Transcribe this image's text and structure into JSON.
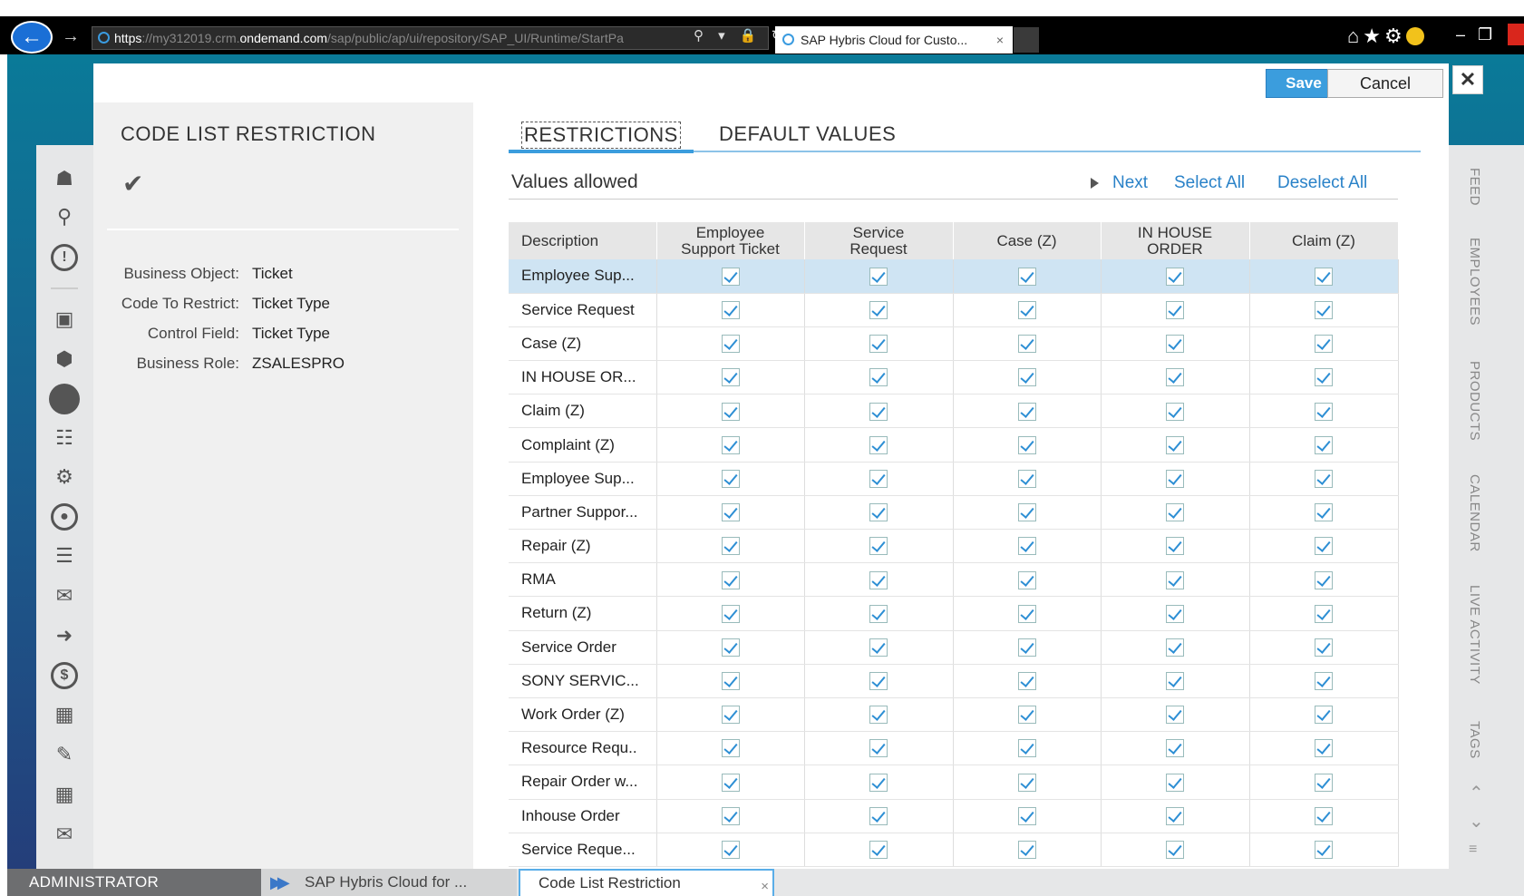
{
  "browser": {
    "url_scheme": "https",
    "url_pre": "://my312019.crm.",
    "url_domain": "ondemand.com",
    "url_path": "/sap/public/ap/ui/repository/SAP_UI/Runtime/StartPa",
    "tab_title": "SAP Hybris Cloud for Custo...",
    "tab_close": "×"
  },
  "dialog": {
    "title": "CODE LIST RESTRICTION",
    "save_label": "Save",
    "cancel_label": "Cancel",
    "close_label": "✕"
  },
  "fields": [
    {
      "label": "Business Object:",
      "value": "Ticket"
    },
    {
      "label": "Code To Restrict:",
      "value": "Ticket Type"
    },
    {
      "label": "Control Field:",
      "value": "Ticket Type"
    },
    {
      "label": "Business Role:",
      "value": "ZSALESPRO"
    }
  ],
  "tabs": {
    "restrictions": "RESTRICTIONS",
    "default_values": "DEFAULT VALUES"
  },
  "values_section": {
    "title": "Values allowed",
    "next": "Next",
    "select_all": "Select All",
    "deselect_all": "Deselect All"
  },
  "table": {
    "headers": [
      "Description",
      "Employee Support Ticket",
      "Service Request",
      "Case (Z)",
      "IN HOUSE ORDER",
      "Claim (Z)"
    ],
    "header_lines": [
      [
        "Description"
      ],
      [
        "Employee",
        "Support Ticket"
      ],
      [
        "Service",
        "Request"
      ],
      [
        "Case (Z)"
      ],
      [
        "IN HOUSE",
        "ORDER"
      ],
      [
        "Claim (Z)"
      ]
    ],
    "rows": [
      {
        "desc": "Employee Sup...",
        "checked": [
          true,
          true,
          true,
          true,
          true
        ],
        "selected": true
      },
      {
        "desc": "Service Request",
        "checked": [
          true,
          true,
          true,
          true,
          true
        ]
      },
      {
        "desc": "Case (Z)",
        "checked": [
          true,
          true,
          true,
          true,
          true
        ]
      },
      {
        "desc": "IN HOUSE OR...",
        "checked": [
          true,
          true,
          true,
          true,
          true
        ]
      },
      {
        "desc": "Claim (Z)",
        "checked": [
          true,
          true,
          true,
          true,
          true
        ]
      },
      {
        "desc": "Complaint (Z)",
        "checked": [
          true,
          true,
          true,
          true,
          true
        ]
      },
      {
        "desc": "Employee Sup...",
        "checked": [
          true,
          true,
          true,
          true,
          true
        ]
      },
      {
        "desc": "Partner Suppor...",
        "checked": [
          true,
          true,
          true,
          true,
          true
        ]
      },
      {
        "desc": "Repair (Z)",
        "checked": [
          true,
          true,
          true,
          true,
          true
        ]
      },
      {
        "desc": "RMA",
        "checked": [
          true,
          true,
          true,
          true,
          true
        ]
      },
      {
        "desc": "Return (Z)",
        "checked": [
          true,
          true,
          true,
          true,
          true
        ]
      },
      {
        "desc": "Service Order",
        "checked": [
          true,
          true,
          true,
          true,
          true
        ]
      },
      {
        "desc": "SONY SERVIC...",
        "checked": [
          true,
          true,
          true,
          true,
          true
        ]
      },
      {
        "desc": "Work Order (Z)",
        "checked": [
          true,
          true,
          true,
          true,
          true
        ]
      },
      {
        "desc": "Resource Requ..",
        "checked": [
          true,
          true,
          true,
          true,
          true
        ]
      },
      {
        "desc": "Repair Order w...",
        "checked": [
          true,
          true,
          true,
          true,
          true
        ]
      },
      {
        "desc": "Inhouse Order",
        "checked": [
          true,
          true,
          true,
          true,
          true
        ]
      },
      {
        "desc": "Service Reque...",
        "checked": [
          true,
          true,
          true,
          true,
          true
        ]
      }
    ]
  },
  "right_nav": [
    "FEED",
    "EMPLOYEES",
    "PRODUCTS",
    "CALENDAR",
    "LIVE ACTIVITY",
    "TAGS"
  ],
  "left_nav_icons": [
    "home-icon",
    "search-icon",
    "alert-icon",
    "org-chart-icon",
    "box-icon",
    "circle-icon",
    "analytics-icon",
    "gear-icon",
    "user-circle-icon",
    "user-list-icon",
    "mail-icon",
    "money-transfer-icon",
    "dollar-icon",
    "user-card-icon",
    "report-edit-icon",
    "calendar-clock-icon",
    "invoice-chat-icon"
  ],
  "bottom": {
    "user": "ADMINISTRATOR",
    "tab1": "SAP Hybris Cloud for ...",
    "tab2": "Code List Restriction",
    "tab2_close": "×"
  },
  "colors": {
    "accent": "#3b9ddd",
    "link": "#2a82c8",
    "selected_row": "#cfe4f3",
    "background_top": "#0a7a98",
    "background_bottom": "#243e7a"
  }
}
